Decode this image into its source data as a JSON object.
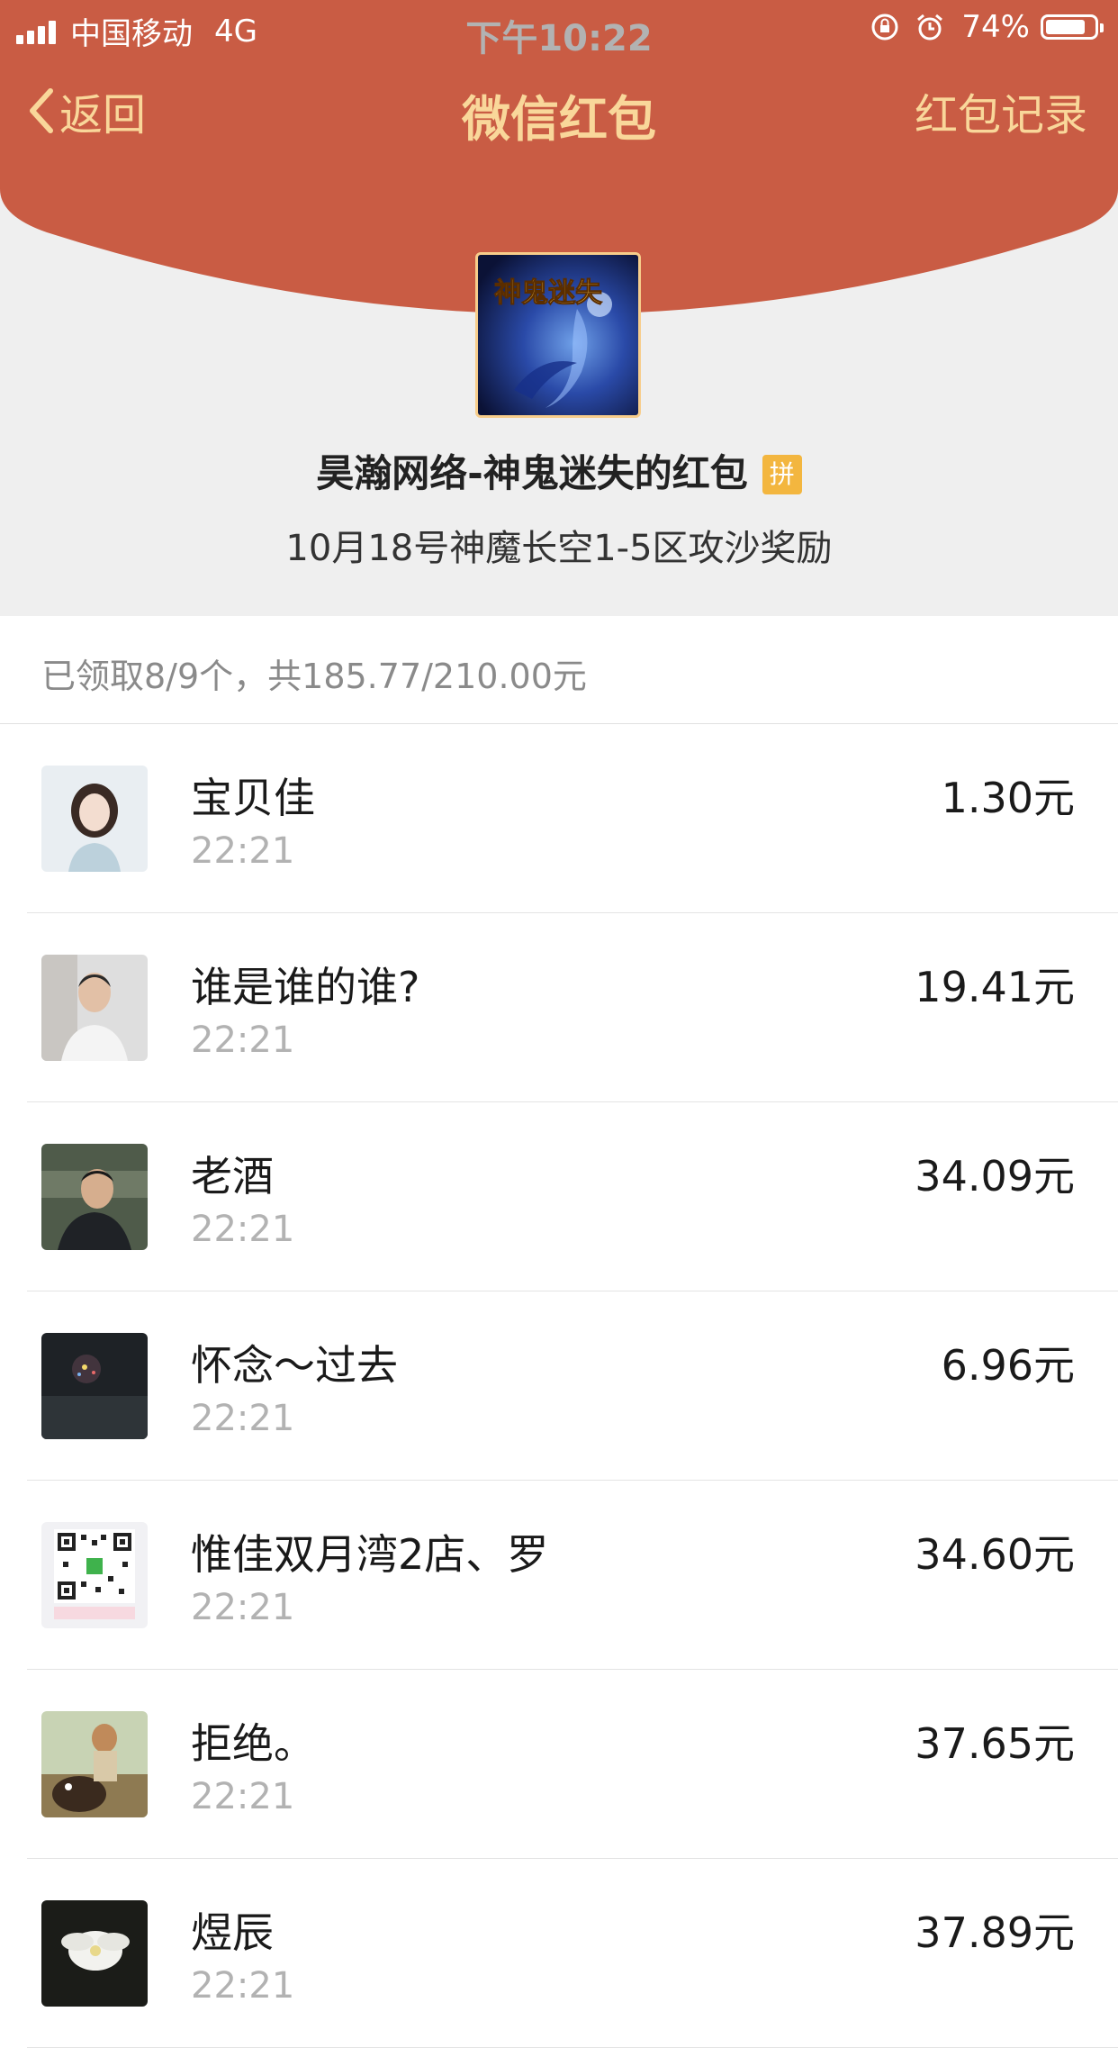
{
  "colors": {
    "header_red": "#c95c44",
    "gold": "#f9d79a",
    "gray_bg": "#efefef",
    "badge": "#f3b63f"
  },
  "status_bar": {
    "carrier": "中国移动",
    "network": "4G",
    "time": "下午10:22",
    "battery": "74%",
    "icons": [
      "signal-icon",
      "rotation-lock-icon",
      "alarm-icon",
      "battery-icon"
    ]
  },
  "nav": {
    "back_label": "返回",
    "title": "微信红包",
    "records_label": "红包记录"
  },
  "packet": {
    "sender": "昊瀚网络-神鬼迷失的红包",
    "badge": "拼",
    "greeting": "10月18号神魔长空1-5区攻沙奖励",
    "logo_text": "神鬼迷失"
  },
  "summary": "已领取8/9个，共185.77/210.00元",
  "receivers": [
    {
      "name": "宝贝佳",
      "time": "22:21",
      "amount": "1.30元",
      "avatar": "portrait-woman"
    },
    {
      "name": "谁是谁的谁?",
      "time": "22:21",
      "amount": "19.41元",
      "avatar": "portrait-man-white-shirt"
    },
    {
      "name": "老酒",
      "time": "22:21",
      "amount": "34.09元",
      "avatar": "portrait-man-dark"
    },
    {
      "name": "怀念～过去",
      "time": "22:21",
      "amount": "6.96元",
      "avatar": "night-photo"
    },
    {
      "name": "惟佳双月湾2店、罗",
      "time": "22:21",
      "amount": "34.60元",
      "avatar": "qr-code"
    },
    {
      "name": "拒绝。",
      "time": "22:21",
      "amount": "37.65元",
      "avatar": "cartoon-dog"
    },
    {
      "name": "煜辰",
      "time": "22:21",
      "amount": "37.89元",
      "avatar": "white-flower"
    }
  ]
}
